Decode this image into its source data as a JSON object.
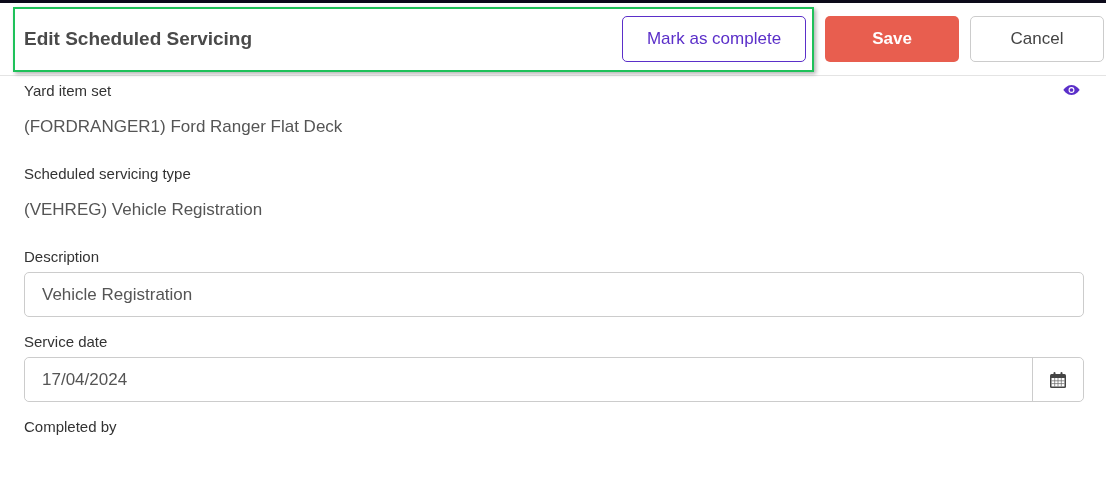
{
  "header": {
    "title": "Edit Scheduled Servicing",
    "highlighted": true,
    "buttons": [
      {
        "label": "Mark as complete",
        "kind": "outline"
      },
      {
        "label": "Save",
        "kind": "primary"
      },
      {
        "label": "Cancel",
        "kind": "plain"
      }
    ]
  },
  "fields": [
    {
      "kind": "readonly",
      "label": "Yard item set",
      "value": "(FORDRANGER1) Ford Ranger Flat Deck",
      "viewable": true
    },
    {
      "kind": "readonly",
      "label": "Scheduled servicing type",
      "value": "(VEHREG) Vehicle Registration"
    },
    {
      "kind": "text",
      "label": "Description",
      "value": "Vehicle Registration"
    },
    {
      "kind": "date",
      "label": "Service date",
      "value": "17/04/2024"
    },
    {
      "kind": "label",
      "label": "Completed by"
    }
  ]
}
